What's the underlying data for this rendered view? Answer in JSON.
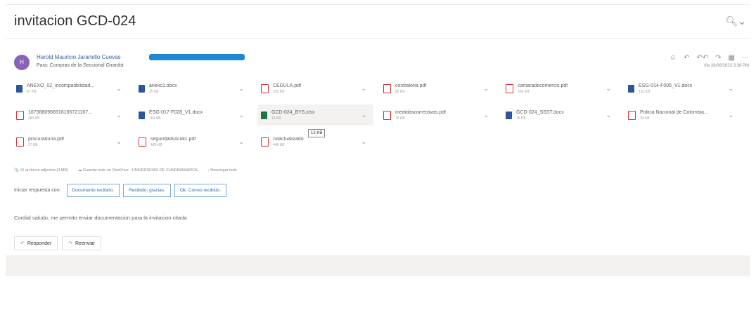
{
  "subject": "invitacion GCD-024",
  "zoom_icon": "zoom-in-icon",
  "sender": {
    "initials": "H",
    "name": "Harold Mauricio Jaramillo Cuevas",
    "to_line": "Para: Compras de la Seccional Girardot",
    "date": "Vie 28/06/2023 3:38 PM",
    "avatar_color": "#8764b8"
  },
  "actions": [
    "emoji-icon",
    "reply-icon",
    "reply-all-icon",
    "forward-icon",
    "apps-icon",
    "more-icon"
  ],
  "attachments": [
    {
      "name": "ANEXO_02_incompatibilidad...",
      "size": "47 KB",
      "type": "doc"
    },
    {
      "name": "anexo1.docx",
      "size": "25 KB",
      "type": "doc"
    },
    {
      "name": "CEDULA.pdf",
      "size": "226 KB",
      "type": "pdf"
    },
    {
      "name": "contraloria.pdf",
      "size": "85 KB",
      "type": "pdf"
    },
    {
      "name": "camaradecomercio.pdf",
      "size": "260 KB",
      "type": "pdf"
    },
    {
      "name": "ESG-014-F005_V1.docx",
      "size": "133 KB",
      "type": "doc"
    },
    {
      "name": "1673880966916165721167...",
      "size": "283 KB",
      "type": "pdf"
    },
    {
      "name": "ESG-017-F028_V1.docx",
      "size": "164 KB",
      "type": "doc"
    },
    {
      "name": "GCD-024_BYS.xlsx",
      "size": "13 KB",
      "type": "xls",
      "selected": true
    },
    {
      "name": "medidascorrectivas.pdf",
      "size": "76 KB",
      "type": "pdf"
    },
    {
      "name": "GCD-024_SSST.docx",
      "size": "76 KB",
      "type": "doc"
    },
    {
      "name": "Policia Nacional de Colombia...",
      "size": "33 KB",
      "type": "pdf"
    },
    {
      "name": "procuraduria.pdf",
      "size": "27 KB",
      "type": "pdf"
    },
    {
      "name": "seguridadsocial1.pdf",
      "size": "465 KB",
      "type": "pdf"
    },
    {
      "name": "rutactualizado",
      "size": "448 KB",
      "type": "pdf",
      "tooltip": "12 KB"
    }
  ],
  "attachment_summary": {
    "count": "15 archivos adjuntos (3 MB)",
    "onedrive": "Guardar todo en OneDrive - UNIVERSIDAD DE CUNDINAMARCA",
    "download": "Descargar todo"
  },
  "quick_reply": {
    "label": "Iniciar respuesta con:",
    "options": [
      "Documento recibido.",
      "Recibido, gracias.",
      "Ok. Correo recibido."
    ]
  },
  "body_text": "Cordial saludo, me permito enviar documentacion para la invitacion citada",
  "reply_buttons": [
    {
      "label": "Responder",
      "icon": "reply-icon"
    },
    {
      "label": "Reenviar",
      "icon": "forward-icon"
    }
  ],
  "colors": {
    "accent": "#2b6aa8",
    "redaction": "#1e88d6"
  }
}
